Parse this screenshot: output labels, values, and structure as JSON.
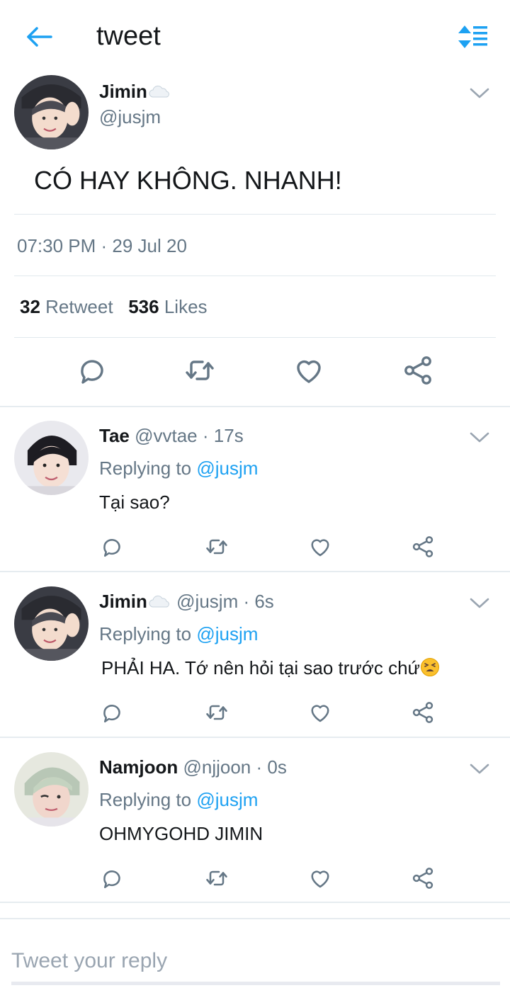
{
  "header": {
    "title": "tweet",
    "back_icon": "arrow-left-icon",
    "sort_icon": "sort-list-icon",
    "accent_color": "#1da1f2"
  },
  "tweet": {
    "name": "Jimin",
    "name_emoji": "cloud",
    "handle": "@jusjm",
    "text": "CÓ HAY KHÔNG. NHANH!",
    "timestamp": "07:30 PM · 29 Jul 20",
    "retweet_count": "32",
    "retweet_label": "Retweet",
    "likes_count": "536",
    "likes_label": "Likes"
  },
  "replies": [
    {
      "name": "Tae",
      "handle": "@vvtae",
      "time": "· 17s",
      "replying_label": "Replying to",
      "replying_to": "@jusjm",
      "text": "Tại sao?"
    },
    {
      "name": "Jimin",
      "name_emoji": "cloud",
      "handle": "@jusjm",
      "time": "· 6s",
      "replying_label": "Replying to",
      "replying_to": "@jusjm",
      "text": "PHẢI HA. Tớ nên hỏi tại sao trước chứ",
      "text_emoji": "tired-face"
    },
    {
      "name": "Namjoon",
      "handle": "@njjoon",
      "time": "· 0s",
      "replying_label": "Replying to",
      "replying_to": "@jusjm",
      "text": "OHMYGOHD JIMIN"
    }
  ],
  "compose": {
    "placeholder": "Tweet your reply"
  },
  "colors": {
    "text_primary": "#14171a",
    "text_secondary": "#657786",
    "link": "#1da1f2",
    "divider": "#e1e8ed"
  }
}
